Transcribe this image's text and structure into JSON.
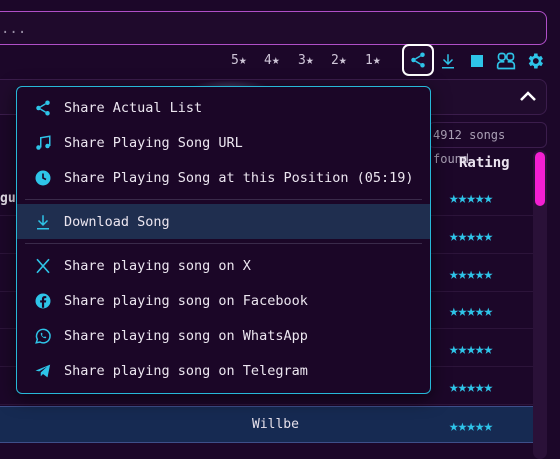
{
  "search": {
    "placeholder": "..."
  },
  "star_filters": [
    "5★",
    "4★",
    "3★",
    "2★",
    "1★"
  ],
  "toolbar": {
    "share_icon": "share-icon",
    "download_icon": "download-icon",
    "stop_icon": "stop-icon",
    "users_icon": "users-icon",
    "settings_icon": "gear-icon"
  },
  "songs_found": "4912 songs found",
  "table": {
    "rating_header": "Rating",
    "partial_cell": "gue",
    "rows": [
      {
        "title": "",
        "rating": "★★★★★"
      },
      {
        "title": "",
        "rating": "★★★★★"
      },
      {
        "title": "",
        "rating": "★★★★★"
      },
      {
        "title": "",
        "rating": "★★★★★"
      },
      {
        "title": "",
        "rating": "★★★★★"
      },
      {
        "title": "",
        "rating": "★★★★★"
      },
      {
        "title": "Willbe",
        "rating": "★★★★★"
      }
    ]
  },
  "menu": {
    "items": [
      {
        "label": "Share Actual List",
        "icon": "share-icon"
      },
      {
        "label": "Share Playing Song URL",
        "icon": "music-note-icon"
      },
      {
        "label": "Share Playing Song at this Position (05:19)",
        "icon": "clock-icon"
      },
      {
        "label": "Download Song",
        "icon": "download-icon"
      },
      {
        "label": "Share playing song on X",
        "icon": "x-logo-icon"
      },
      {
        "label": "Share playing song on Facebook",
        "icon": "facebook-icon"
      },
      {
        "label": "Share playing song on WhatsApp",
        "icon": "whatsapp-icon"
      },
      {
        "label": "Share playing song on Telegram",
        "icon": "telegram-icon"
      }
    ]
  },
  "colors": {
    "accent": "#2ec4e8",
    "border": "#b04fc8",
    "scrollbar": "#f21fd1",
    "background": "#1c0729"
  }
}
